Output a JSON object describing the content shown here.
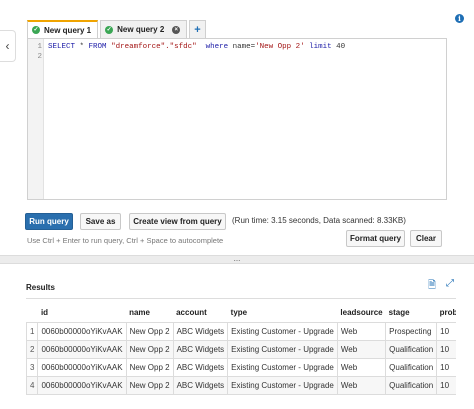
{
  "toggle": {
    "icon": "chevron-left-icon",
    "glyph": "‹"
  },
  "info": {
    "icon": "info-icon",
    "glyph": "i"
  },
  "tabs": [
    {
      "label": "New query 1",
      "status": "ok",
      "active": true
    },
    {
      "label": "New query 2",
      "status": "ok",
      "active": false,
      "closable": true
    }
  ],
  "add_tab_glyph": "+",
  "editor": {
    "line_numbers": [
      "1",
      "2"
    ],
    "line1": {
      "kw_select": "SELECT",
      "star": " * ",
      "kw_from": "FROM",
      "space1": " ",
      "table": "\"dreamforce\".\"sfdc\"",
      "space2": "  ",
      "kw_where": "where",
      "cond": " name=",
      "value": "'New Opp 2'",
      "space3": " ",
      "kw_limit": "limit",
      "limit": " 40"
    }
  },
  "buttons": {
    "run": "Run query",
    "save": "Save as",
    "create_view": "Create view from query",
    "format": "Format query",
    "clear": "Clear"
  },
  "run_info": "(Run time: 3.15 seconds, Data scanned: 8.33KB)",
  "hint": "Use Ctrl + Enter to run query, Ctrl + Space to autocomplete",
  "divider_glyph": "...",
  "results": {
    "title": "Results",
    "columns": [
      "",
      "id",
      "name",
      "account",
      "type",
      "leadsource",
      "stage",
      "probability"
    ],
    "rows": [
      [
        "1",
        "0060b00000oYiKvAAK",
        "New Opp 2",
        "ABC Widgets",
        "Existing Customer - Upgrade",
        "Web",
        "Prospecting",
        "10"
      ],
      [
        "2",
        "0060b00000oYiKvAAK",
        "New Opp 2",
        "ABC Widgets",
        "Existing Customer - Upgrade",
        "Web",
        "Qualification",
        "10"
      ],
      [
        "3",
        "0060b00000oYiKvAAK",
        "New Opp 2",
        "ABC Widgets",
        "Existing Customer - Upgrade",
        "Web",
        "Qualification",
        "10"
      ],
      [
        "4",
        "0060b00000oYiKvAAK",
        "New Opp 2",
        "ABC Widgets",
        "Existing Customer - Upgrade",
        "Web",
        "Qualification",
        "10"
      ]
    ]
  },
  "colors": {
    "primary": "#2a6fae",
    "tab_accent": "#f0a400",
    "ok": "#3aa654"
  }
}
